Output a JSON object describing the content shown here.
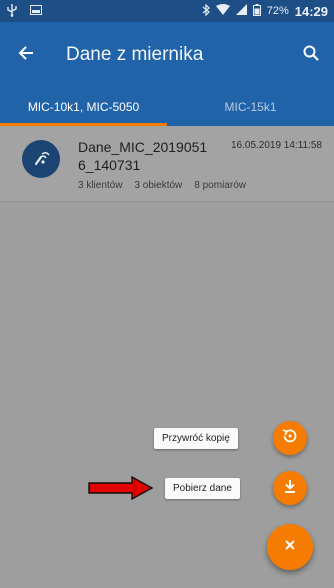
{
  "status_bar": {
    "battery_text": "72%",
    "time": "14:29",
    "icons": [
      "usb-icon",
      "image-icon",
      "bluetooth-icon",
      "wifi-icon",
      "signal-icon",
      "battery-icon"
    ]
  },
  "app_bar": {
    "title": "Dane z miernika",
    "back_icon": "arrow-back-icon",
    "search_icon": "search-icon"
  },
  "tabs": [
    {
      "label": "MIC-10k1, MIC-5050",
      "active": true
    },
    {
      "label": "MIC-15k1",
      "active": false
    }
  ],
  "list": {
    "items": [
      {
        "name": "Dane_MIC_20190516_140731",
        "date": "16.05.2019 14:11:58",
        "clients": "3 klientów",
        "objects": "3 obiektów",
        "measurements": "8 pomiarów",
        "icon": "meter-probe-icon"
      }
    ]
  },
  "fab": {
    "restore_label": "Przywróć kopię",
    "download_label": "Pobierz dane",
    "restore_icon": "restore-icon",
    "download_icon": "download-icon",
    "close_icon": "close-icon"
  },
  "colors": {
    "status_bar": "#1d4f86",
    "app_bar": "#2163a8",
    "accent": "#f57c00",
    "scrim": "#9e9e9e",
    "annotation_arrow": "#e00000"
  }
}
